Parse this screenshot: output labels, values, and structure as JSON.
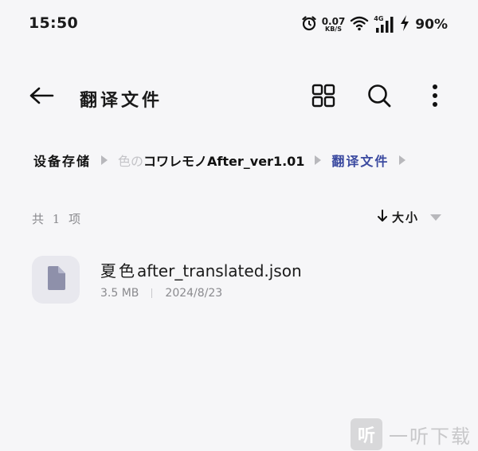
{
  "status_bar": {
    "time": "15:50",
    "net_speed_value": "0.07",
    "net_speed_unit": "KB/S",
    "network_label": "4G",
    "battery": "90%",
    "icons": [
      "alarm-icon",
      "wifi-icon",
      "signal-icon",
      "charging-icon"
    ]
  },
  "toolbar": {
    "title": "翻译文件",
    "icons": [
      "back-arrow-icon",
      "grid-view-icon",
      "search-icon",
      "more-vertical-icon"
    ]
  },
  "breadcrumb": {
    "root": "设备存储",
    "middle_faded": "色の",
    "middle": "コワレモノAfter_ver1.01",
    "current": "翻译文件"
  },
  "list_header": {
    "count": "共 1 项",
    "sort_label": "大小"
  },
  "files": [
    {
      "name_cjk": "夏色",
      "name_rest": "after_translated.json",
      "size": "3.5 MB",
      "date": "2024/8/23"
    }
  ],
  "watermark": {
    "logo_char": "听",
    "text": "一听下载"
  },
  "colors": {
    "background": "#f6f6f8",
    "breadcrumb_current": "#3b4aa0",
    "secondary_text": "#8a8a8e",
    "file_icon": "#8e90aa",
    "thumb_bg": "#e8e8ee"
  }
}
